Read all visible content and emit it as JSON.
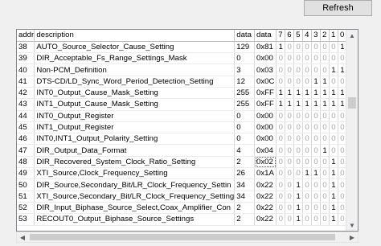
{
  "toolbar": {
    "refresh_label": "Refresh"
  },
  "table": {
    "columns": [
      "addr",
      "description",
      "data",
      "data",
      "7",
      "6",
      "5",
      "4",
      "3",
      "2",
      "1",
      "0"
    ],
    "rows": [
      [
        "38",
        "AUTO_Source_Selector_Cause_Setting",
        "129",
        "0x81",
        "1",
        "0",
        "0",
        "0",
        "0",
        "0",
        "0",
        "1"
      ],
      [
        "39",
        "DIR_Acceptable_Fs_Range_Settings_Mask",
        "0",
        "0x00",
        "0",
        "0",
        "0",
        "0",
        "0",
        "0",
        "0",
        "0"
      ],
      [
        "40",
        "Non-PCM_Definition",
        "3",
        "0x03",
        "0",
        "0",
        "0",
        "0",
        "0",
        "0",
        "1",
        "1"
      ],
      [
        "41",
        "DTS-CD/LD_Sync_Word_Period_Detection_Setting",
        "12",
        "0x0C",
        "0",
        "0",
        "0",
        "0",
        "1",
        "1",
        "0",
        "0"
      ],
      [
        "42",
        "INT0_Output_Cause_Mask_Setting",
        "255",
        "0xFF",
        "1",
        "1",
        "1",
        "1",
        "1",
        "1",
        "1",
        "1"
      ],
      [
        "43",
        "INT1_Output_Cause_Mask_Setting",
        "255",
        "0xFF",
        "1",
        "1",
        "1",
        "1",
        "1",
        "1",
        "1",
        "1"
      ],
      [
        "44",
        "INT0_Output_Register",
        "0",
        "0x00",
        "0",
        "0",
        "0",
        "0",
        "0",
        "0",
        "0",
        "0"
      ],
      [
        "45",
        "INT1_Output_Register",
        "0",
        "0x00",
        "0",
        "0",
        "0",
        "0",
        "0",
        "0",
        "0",
        "0"
      ],
      [
        "46",
        "INT0,INT1_Output_Polarity_Setting",
        "0",
        "0x00",
        "0",
        "0",
        "0",
        "0",
        "0",
        "0",
        "0",
        "0"
      ],
      [
        "47",
        "DIR_Output_Data_Format",
        "4",
        "0x04",
        "0",
        "0",
        "0",
        "0",
        "0",
        "1",
        "0",
        "0"
      ],
      [
        "48",
        "DIR_Recovered_System_Clock_Ratio_Setting",
        "2",
        "0x02",
        "0",
        "0",
        "0",
        "0",
        "0",
        "0",
        "1",
        "0"
      ],
      [
        "49",
        "XTI_Source,Clock_Frequency_Setting",
        "26",
        "0x1A",
        "0",
        "0",
        "0",
        "1",
        "1",
        "0",
        "1",
        "0"
      ],
      [
        "50",
        "DIR_Source,Secondary_Bit/LR_Clock_Frequency_Settin",
        "34",
        "0x22",
        "0",
        "0",
        "1",
        "0",
        "0",
        "0",
        "1",
        "0"
      ],
      [
        "51",
        "XTI_Source,Secondary_Bit/LR_Clock_Frequency_Setting",
        "34",
        "0x22",
        "0",
        "0",
        "1",
        "0",
        "0",
        "0",
        "1",
        "0"
      ],
      [
        "52",
        "DIR_Input_Biphase_Source_Select,Coax_Amplifier_Con",
        "2",
        "0x22",
        "0",
        "0",
        "1",
        "0",
        "0",
        "0",
        "1",
        "0"
      ],
      [
        "53",
        "RECOUT0_Output_Biphase_Source_Settings",
        "2",
        "0x22",
        "0",
        "0",
        "1",
        "0",
        "0",
        "0",
        "1",
        "0"
      ]
    ]
  },
  "selection": {
    "row": 10,
    "col": 3
  },
  "icons": {
    "scroll_up": "scroll-up-arrow-icon",
    "scroll_down": "scroll-down-arrow-icon",
    "scroll_left": "scroll-left-arrow-icon",
    "scroll_right": "scroll-right-arrow-icon"
  }
}
